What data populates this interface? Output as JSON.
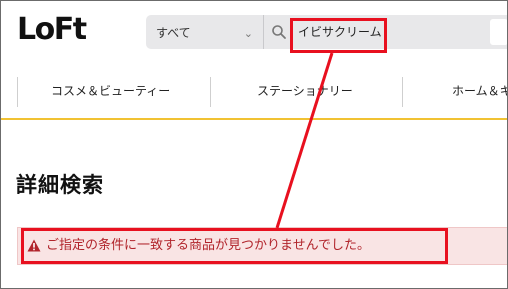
{
  "header": {
    "logo": "LoFt",
    "search": {
      "category": "すべて",
      "query": "イビサクリーム"
    }
  },
  "nav": {
    "items": [
      {
        "label": "コスメ＆ビューティー"
      },
      {
        "label": "ステーショナリー"
      },
      {
        "label": "ホーム＆キ"
      }
    ]
  },
  "main": {
    "title": "詳細検索",
    "alert": "ご指定の条件に一致する商品が見つかりませんでした。"
  },
  "icons": {
    "search": "magnifier-icon",
    "chevron": "chevron-down-icon",
    "alert": "warning-triangle-icon"
  },
  "colors": {
    "accent_rule": "#f1c232",
    "alert_text": "#b1242b",
    "alert_bg": "#f9e4e4",
    "annotation": "#e8101f"
  }
}
